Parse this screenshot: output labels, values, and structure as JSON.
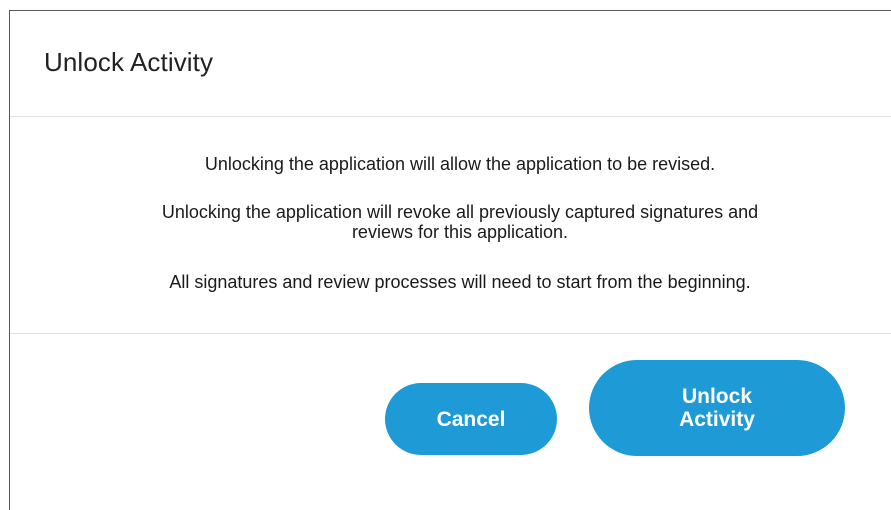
{
  "dialog": {
    "title": "Unlock Activity",
    "messages": {
      "line1": "Unlocking the application will allow the application to be revised.",
      "line2a": "Unlocking the application will revoke all previously captured signatures and",
      "line2b": "reviews for this application.",
      "line3": "All signatures and review processes will need to start from the beginning."
    },
    "buttons": {
      "cancel": "Cancel",
      "unlock_line1": "Unlock",
      "unlock_line2": "Activity"
    }
  },
  "colors": {
    "button_bg": "#1e9bd7",
    "button_text": "#ffffff",
    "divider": "#e2e2e2",
    "border": "#595959"
  }
}
